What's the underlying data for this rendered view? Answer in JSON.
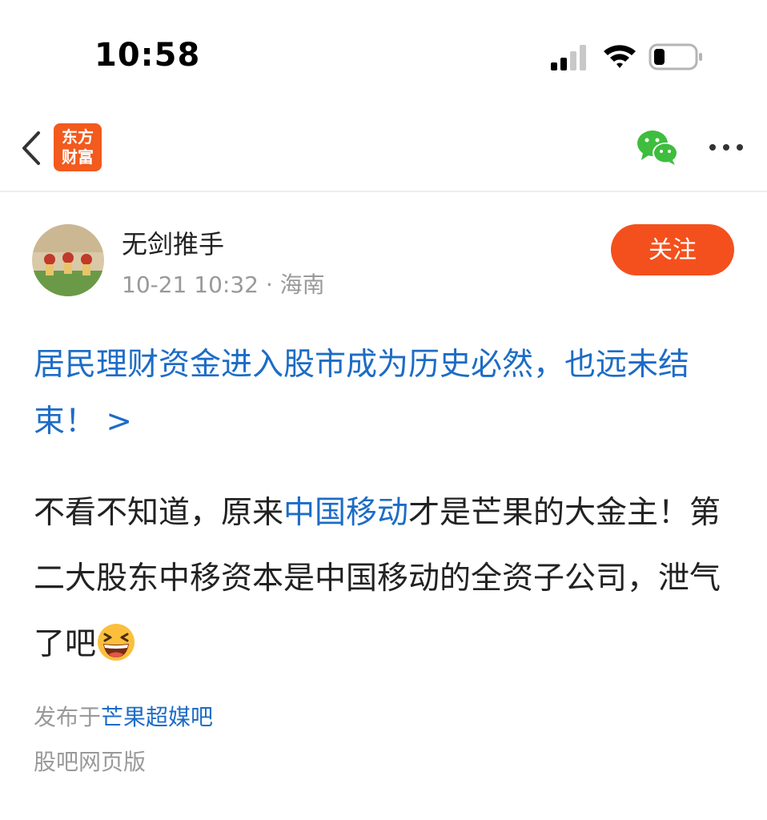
{
  "status_bar": {
    "time": "10:58"
  },
  "nav": {
    "logo_line1": "东方",
    "logo_line2": "财富",
    "accent": "#f25a1e"
  },
  "post": {
    "author": "无剑推手",
    "date_time": "10-21 10:32",
    "separator": " · ",
    "location": "海南",
    "follow_label": "关注",
    "headline": "居民理财资金进入股市成为历史必然，也远未结束！ >",
    "body_before": "不看不知道，原来",
    "body_link": "中国移动",
    "body_after": "才是芒果的大金主！第二大股东中移资本是中国移动的全资子公司，泄气了吧",
    "emoji_icon": "grinning-squinting-face-icon",
    "publish_prefix": "发布于",
    "forum_name": "芒果超媒吧",
    "web_version": "股吧网页版"
  },
  "colors": {
    "link": "#1d6cc6",
    "follow": "#f4501d",
    "meta": "#999999"
  }
}
